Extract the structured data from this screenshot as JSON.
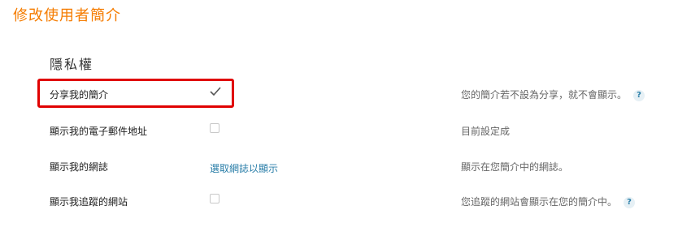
{
  "page_title": "修改使用者簡介",
  "section_title": "隱私權",
  "rows": [
    {
      "label": "分享我的簡介",
      "checked": true,
      "description": "您的簡介若不設為分享，就不會顯示。",
      "help": "?"
    },
    {
      "label": "顯示我的電子郵件地址",
      "checked": false,
      "description": "目前設定成"
    },
    {
      "label": "顯示我的網誌",
      "link": "選取網誌以顯示",
      "description": "顯示在您簡介中的網誌。"
    },
    {
      "label": "顯示我追蹤的網站",
      "checked": false,
      "description": "您追蹤的網站會顯示在您的簡介中。",
      "help": "?"
    }
  ],
  "colors": {
    "title": "#f57c00",
    "link": "#2a7ea8",
    "highlight": "#e00000"
  }
}
